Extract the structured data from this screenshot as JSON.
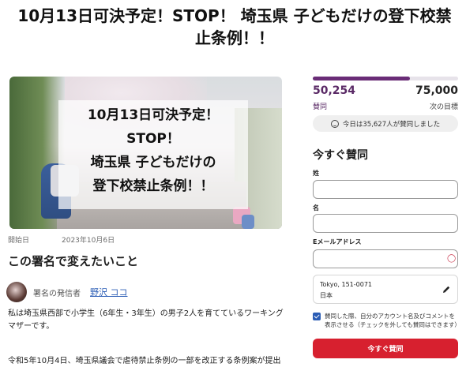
{
  "page": {
    "title": "10月13日可決予定！STOP！ 埼玉県 子どもだけの登下校禁止条例！！"
  },
  "hero": {
    "overlay_text": "10月13日可決予定！\nSTOP！\n埼玉県 子どもだけの\n登下校禁止条例！！"
  },
  "meta": {
    "start_label": "開始日",
    "start_date": "2023年10月6日"
  },
  "content": {
    "section_title": "この署名で変えたいこと",
    "author_label": "署名の発信者",
    "author_name": "野沢 ココ",
    "paragraph1": "私は埼玉県西部で小学生（6年生・3年生）の男子2人を育てているワーキングマザーです。",
    "paragraph2": "令和5年10月4日、埼玉県議会で虐待禁止条例の一部を改正する条例案が提出され"
  },
  "progress": {
    "count": "50,254",
    "count_label": "賛同",
    "goal": "75,000",
    "goal_label": "次の目標",
    "fraction": 0.67,
    "today_text": "今日は35,627人が賛同しました",
    "today_icon": "smile-icon"
  },
  "form": {
    "title": "今すぐ賛同",
    "first_name_label": "姓",
    "last_name_label": "名",
    "email_label": "Eメールアドレス",
    "location_line1": "Tokyo, 151-0071",
    "location_line2": "日本",
    "consent_text": "賛同した際、自分のアカウント名及びコメントを表示させる（チェックを外しても賛同はできます）",
    "consent_checked": true,
    "submit_label": "今すぐ賛同"
  },
  "colors": {
    "accent": "#d7202f",
    "progress": "#6a2d77",
    "link": "#2b5db5"
  }
}
